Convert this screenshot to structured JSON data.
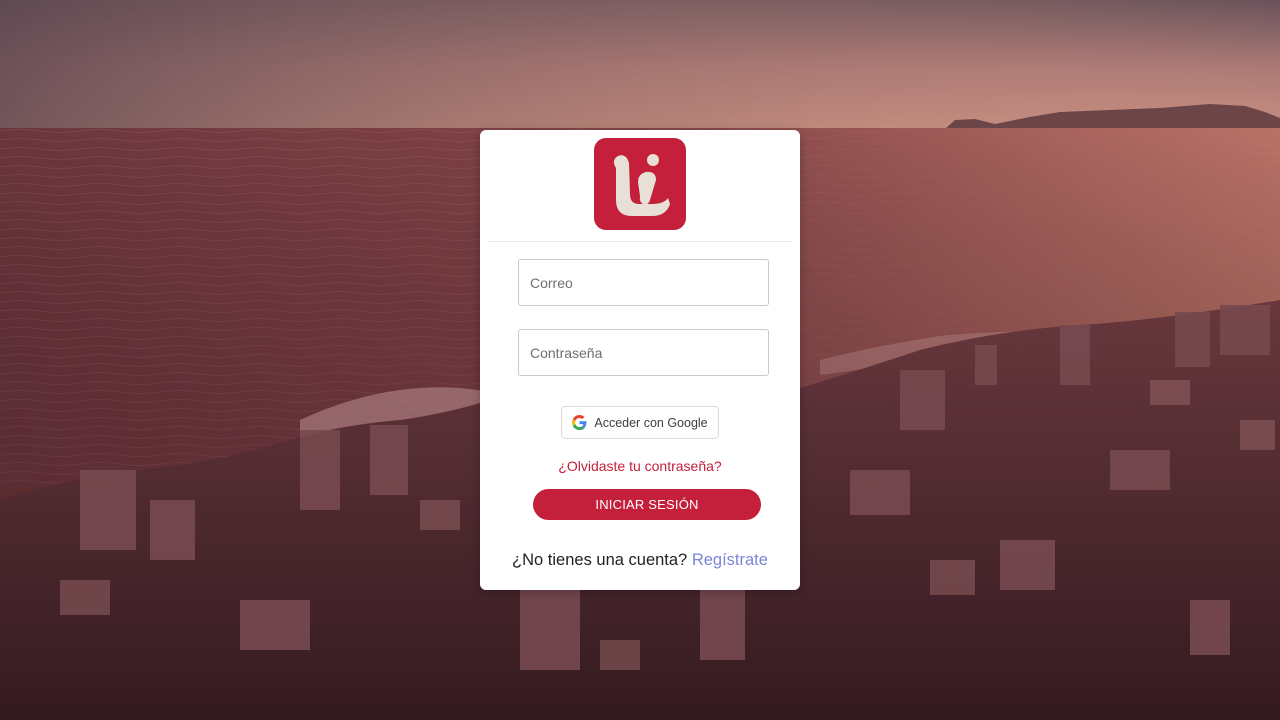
{
  "background": {
    "description_icon": "coastal-city-aerial-photo"
  },
  "logo": {
    "icon": "brand-logo-icon",
    "color": "#c4203b"
  },
  "form": {
    "email_placeholder": "Correo",
    "email_value": "",
    "password_placeholder": "Contraseña",
    "password_value": "",
    "google_label": "Acceder con Google",
    "google_icon": "google-icon",
    "forgot_label": "¿Olvidaste tu contraseña?",
    "submit_label": "INICIAR SESIÓN"
  },
  "signup": {
    "prompt": "¿No tienes una cuenta?",
    "link_label": "Regístrate"
  },
  "colors": {
    "accent": "#c4203b",
    "link": "#7b86d8"
  }
}
